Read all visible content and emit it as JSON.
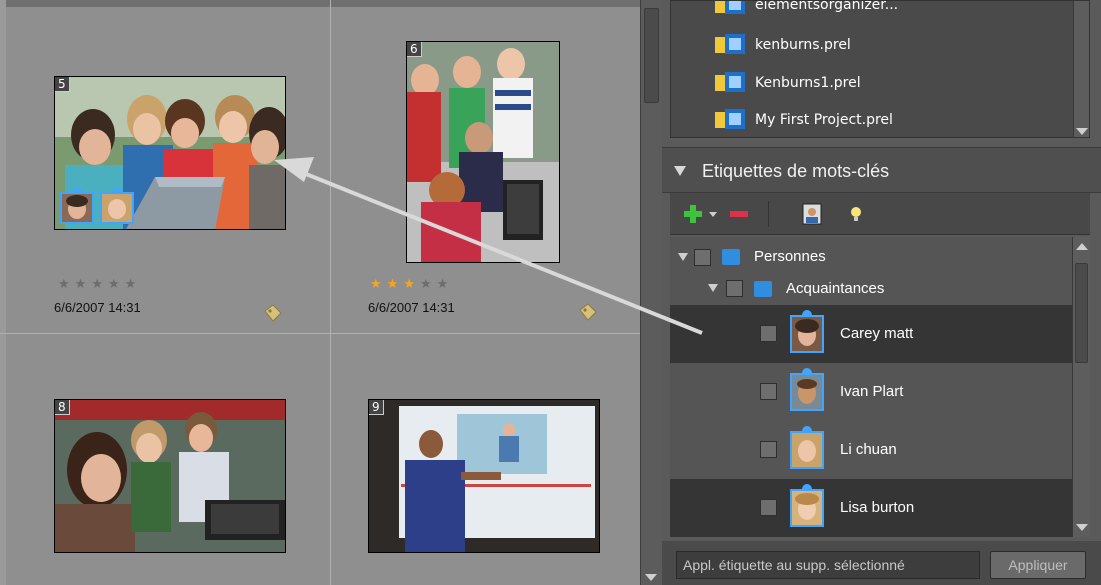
{
  "grid": {
    "items": [
      {
        "number": "5",
        "rating": 0,
        "date": "6/6/2007 14:31"
      },
      {
        "number": "6",
        "rating": 3,
        "date": "6/6/2007 14:31"
      },
      {
        "number": "8"
      },
      {
        "number": "9"
      }
    ],
    "star_glyph_on": "★",
    "star_glyph_off": "★"
  },
  "files": {
    "items": [
      {
        "name": "elementsorganizer..."
      },
      {
        "name": "kenburns.prel"
      },
      {
        "name": "Kenburns1.prel"
      },
      {
        "name": "My First Project.prel"
      }
    ]
  },
  "keywords": {
    "title": "Etiquettes de mots-clés",
    "categories": [
      {
        "label": "Personnes"
      },
      {
        "label": "Acquaintances"
      }
    ],
    "people": [
      {
        "label": "Carey matt",
        "selected": true
      },
      {
        "label": "Ivan Plart",
        "selected": false
      },
      {
        "label": "Li chuan",
        "selected": false
      },
      {
        "label": "Lisa burton",
        "selected": true
      }
    ]
  },
  "apply": {
    "placeholder": "Appl. étiquette au supp. sélectionné",
    "button_label": "Appliquer"
  },
  "colors": {
    "accent": "#3fa5ff",
    "star": "#f5a71c",
    "add": "#3cc43c",
    "remove": "#e0304a"
  },
  "icons": {
    "add": "plus-icon",
    "remove": "minus-icon",
    "new_photo": "photo-icon",
    "lightbulb": "lightbulb-icon",
    "tag": "tag-icon",
    "file": "premiere-project-icon"
  }
}
